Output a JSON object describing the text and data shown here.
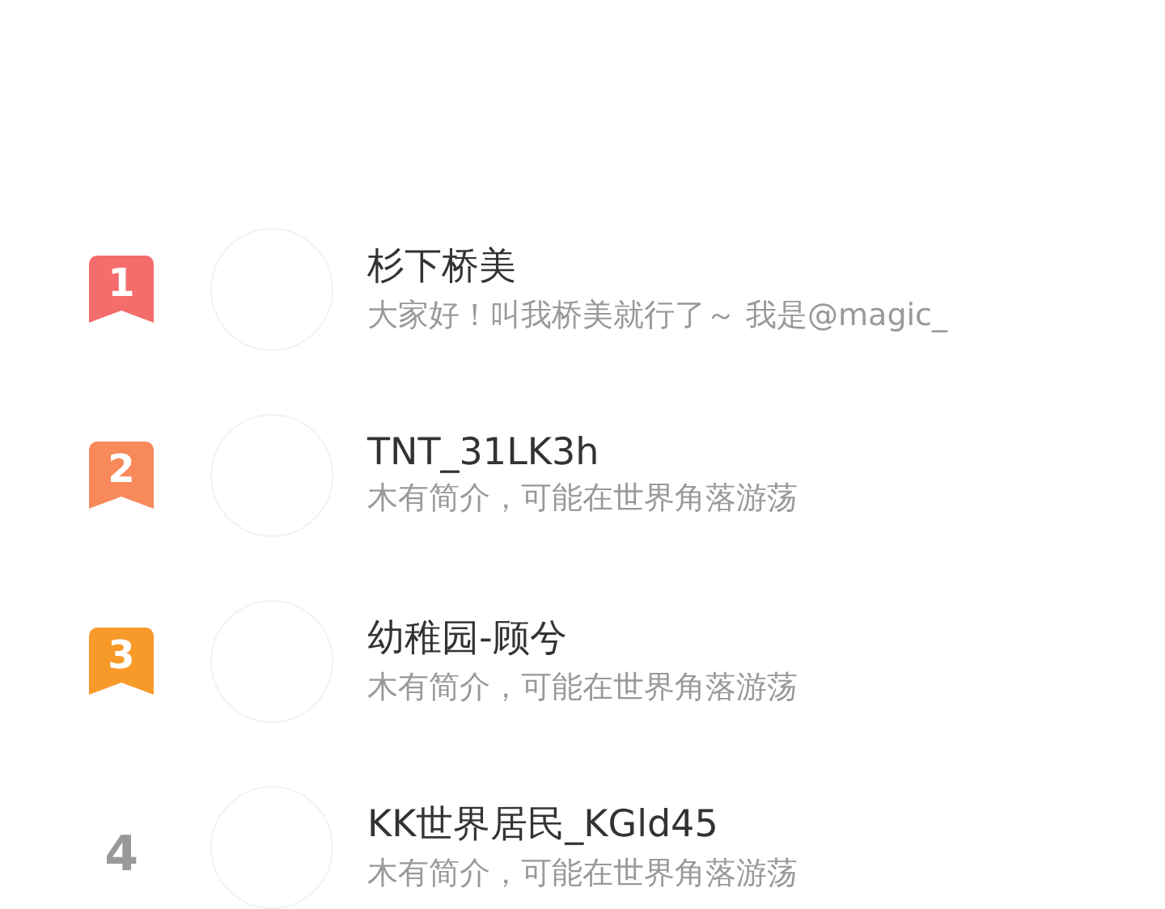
{
  "ranking": [
    {
      "rank": "1",
      "kind": "ribbon",
      "color": "#f56c6c",
      "name": "杉下桥美",
      "bio": "大家好！叫我桥美就行了～ 我是@magic_"
    },
    {
      "rank": "2",
      "kind": "ribbon",
      "color": "#f7895a",
      "name": "TNT_31LK3h",
      "bio": "木有简介，可能在世界角落游荡"
    },
    {
      "rank": "3",
      "kind": "ribbon",
      "color": "#f79a2a",
      "name": "幼稚园-顾兮",
      "bio": "木有简介，可能在世界角落游荡"
    },
    {
      "rank": "4",
      "kind": "plain",
      "name": "KK世界居民_KGld45",
      "bio": "木有简介，可能在世界角落游荡"
    }
  ]
}
